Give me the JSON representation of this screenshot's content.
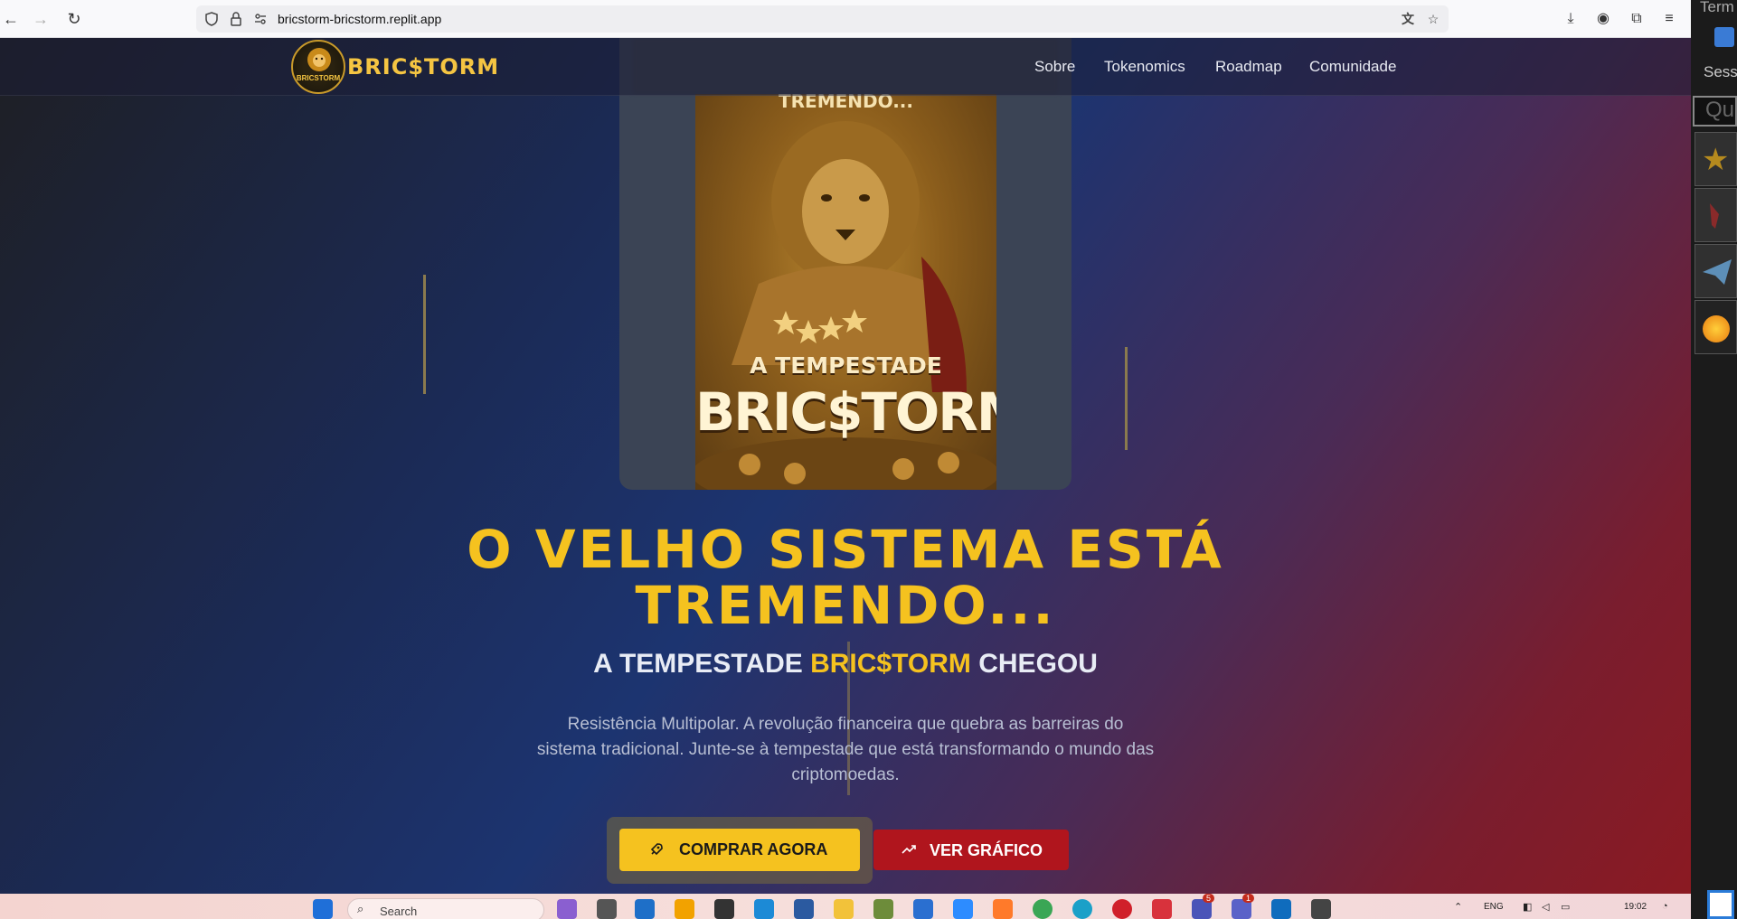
{
  "browser": {
    "url": "bricstorm-bricstorm.replit.app",
    "back_label": "←",
    "forward_label": "→",
    "reload_label": "↻"
  },
  "site": {
    "brand": "BRIC$TORM",
    "logo_mini": "BRICSTORM",
    "menu": [
      "Sobre",
      "Tokenomics",
      "Roadmap",
      "Comunidade"
    ]
  },
  "poster": {
    "top_text": "TREMENDO...",
    "subtitle": "A TEMPESTADE",
    "title": "BRIC$TORM"
  },
  "hero": {
    "headline_line1": "O VELHO SISTEMA ESTÁ",
    "headline_line2": "TREMENDO...",
    "subhead_pre": "A TEMPESTADE ",
    "subhead_hl": "BRIC$TORM",
    "subhead_post": " CHEGOU",
    "desc_line1": "Resistência Multipolar. A revolução financeira que quebra as barreiras do",
    "desc_line2": "sistema tradicional. Junte-se à tempestade que está transformando o mundo das",
    "desc_line3": "criptomoedas.",
    "buy_label": "COMPRAR AGORA",
    "chart_label": "VER GRÁFICO"
  },
  "side_panel": {
    "top_text": "Term",
    "session_text": "Sessi",
    "input_text": "Qu"
  },
  "taskbar": {
    "search_placeholder": "Search",
    "lang": "ENG",
    "time": "19:02",
    "badge_teams": "5",
    "badge_teams2": "1"
  },
  "colors": {
    "accent_gold": "#f5c21f",
    "accent_red": "#b0151d"
  }
}
